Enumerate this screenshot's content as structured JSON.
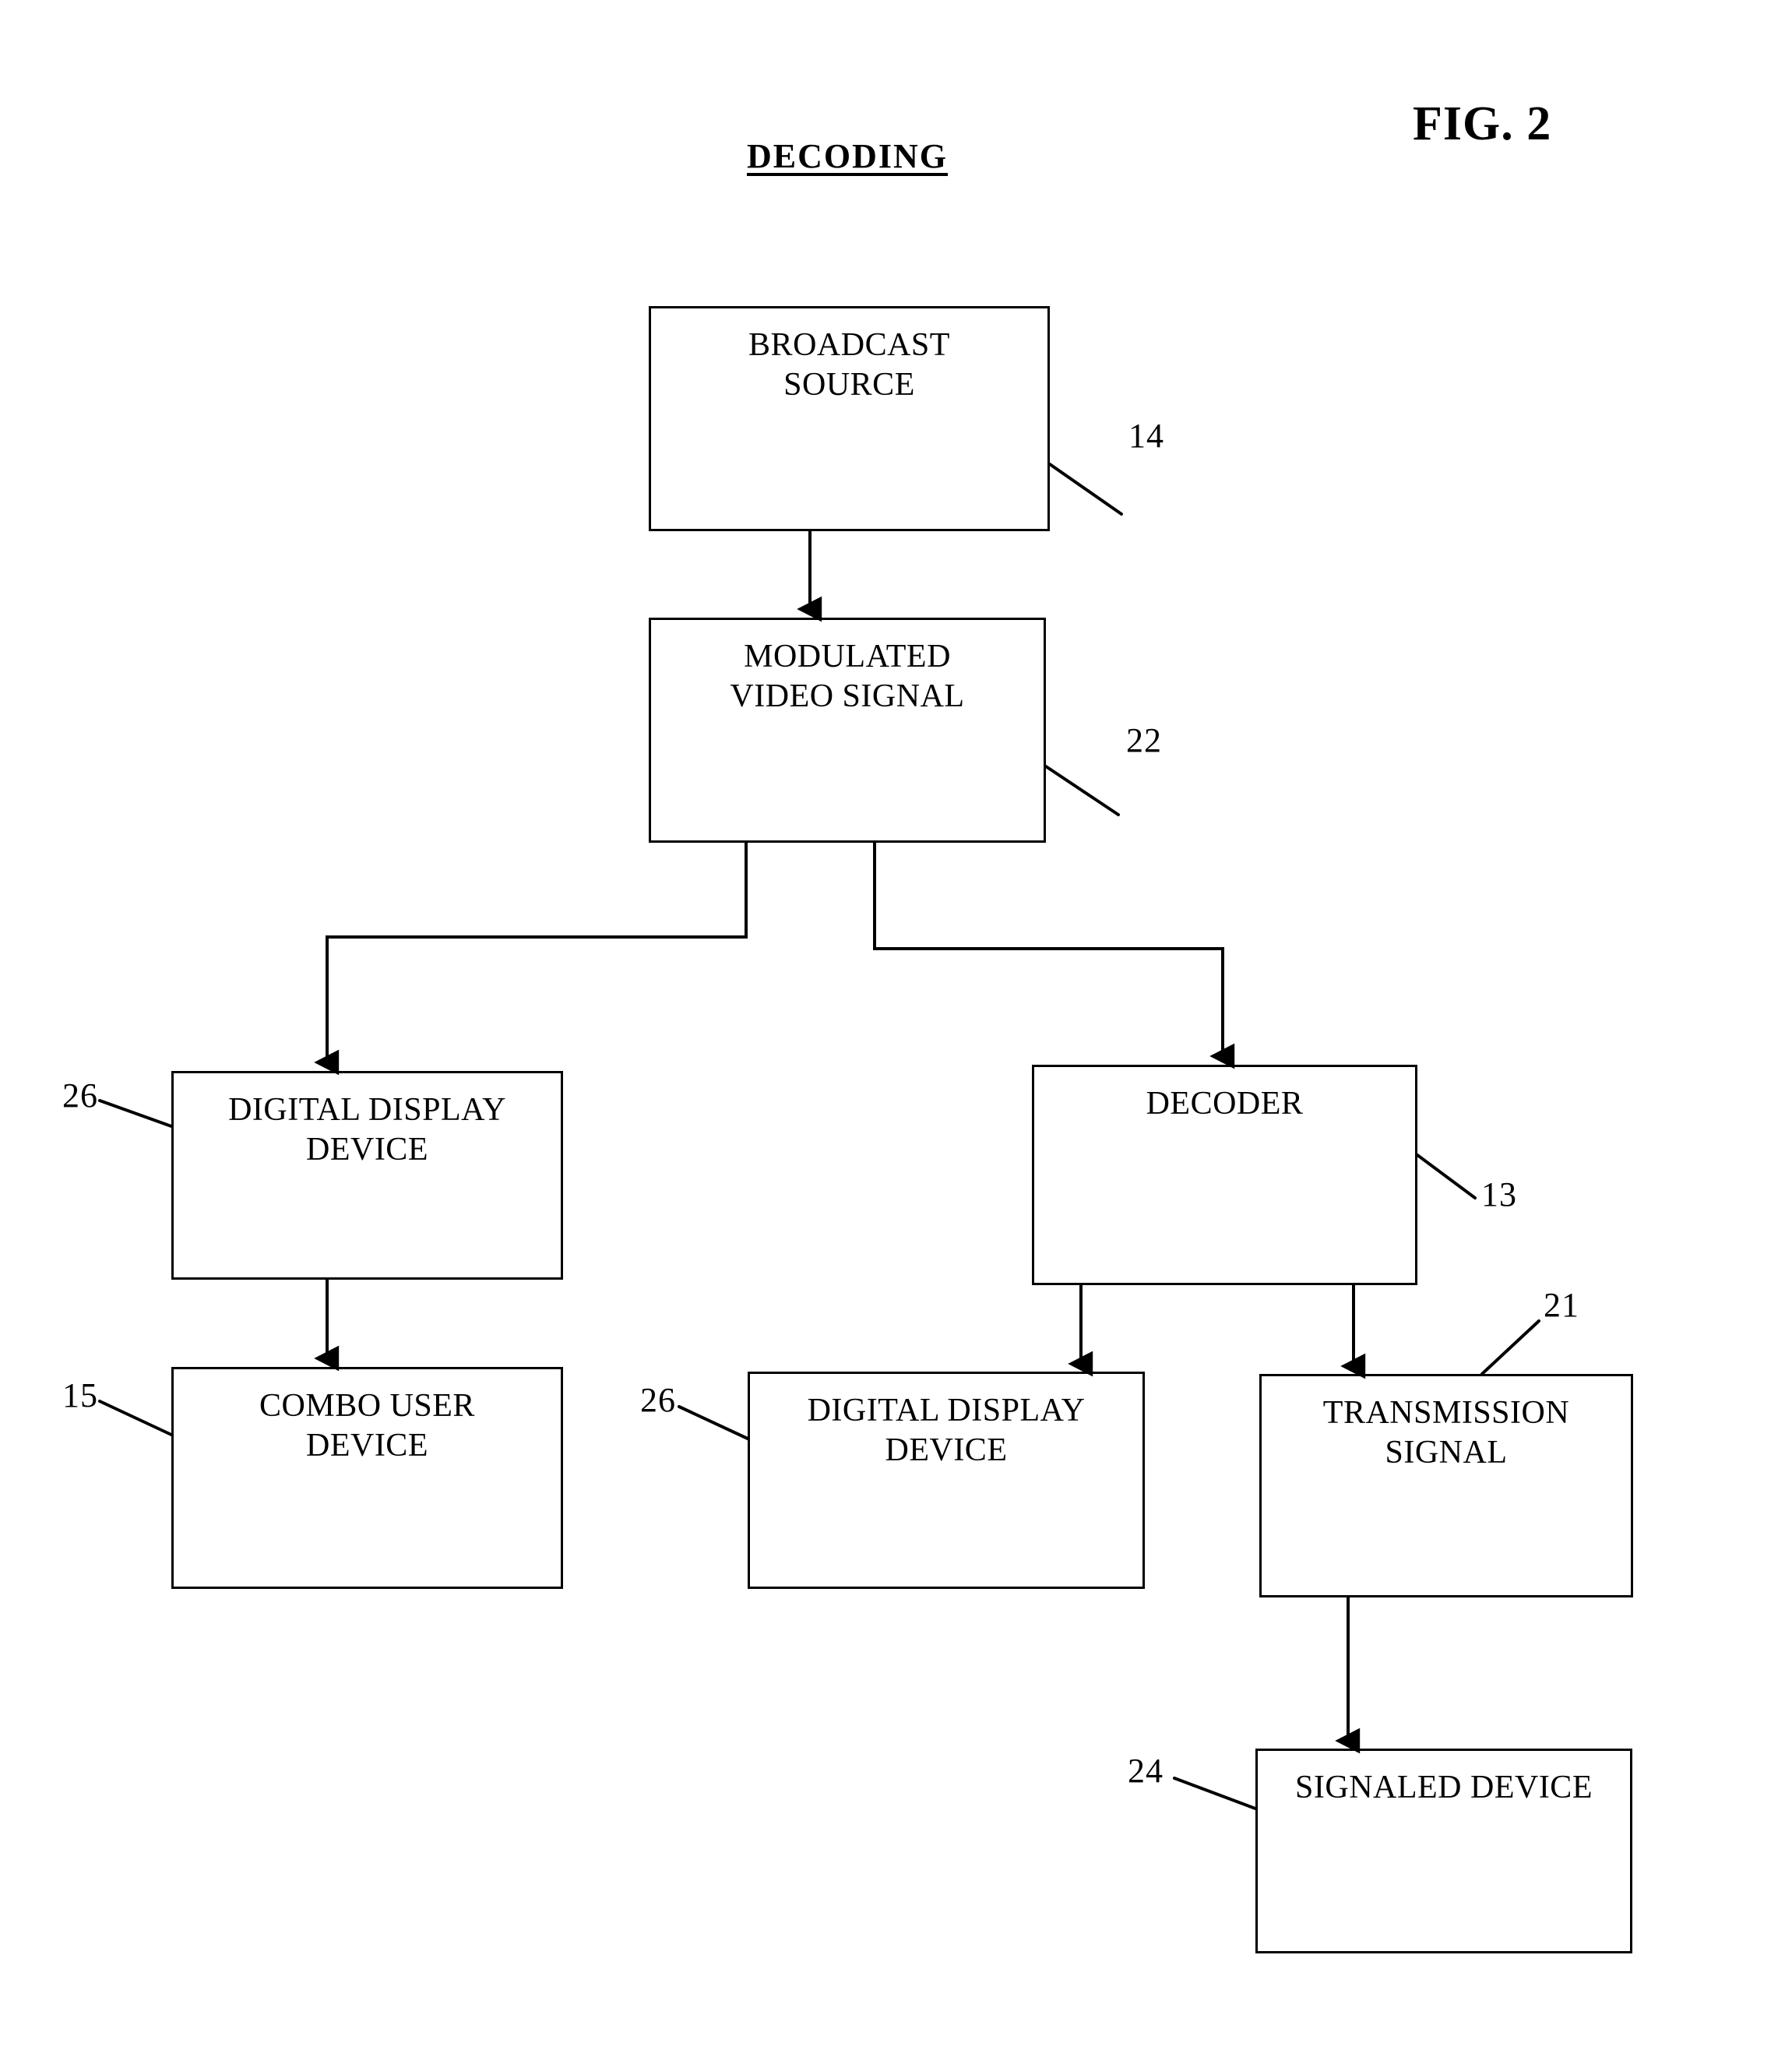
{
  "figure": {
    "number_label": "FIG. 2",
    "title": "DECODING"
  },
  "nodes": [
    {
      "id": "broadcast-source",
      "label": "BROADCAST\nSOURCE",
      "ref": "14"
    },
    {
      "id": "modulated-video-signal",
      "label": "MODULATED\nVIDEO SIGNAL",
      "ref": "22"
    },
    {
      "id": "digital-display-device-left",
      "label": "DIGITAL DISPLAY\nDEVICE",
      "ref": "26"
    },
    {
      "id": "decoder",
      "label": "DECODER",
      "ref": "13"
    },
    {
      "id": "combo-user-device",
      "label": "COMBO USER\nDEVICE",
      "ref": "15"
    },
    {
      "id": "digital-display-device-mid",
      "label": "DIGITAL DISPLAY\nDEVICE",
      "ref": "26"
    },
    {
      "id": "transmission-signal",
      "label": "TRANSMISSION\nSIGNAL",
      "ref": "21"
    },
    {
      "id": "signaled-device",
      "label": "SIGNALED DEVICE",
      "ref": "24"
    }
  ],
  "colors": {
    "ink": "#000000",
    "paper": "#ffffff"
  }
}
